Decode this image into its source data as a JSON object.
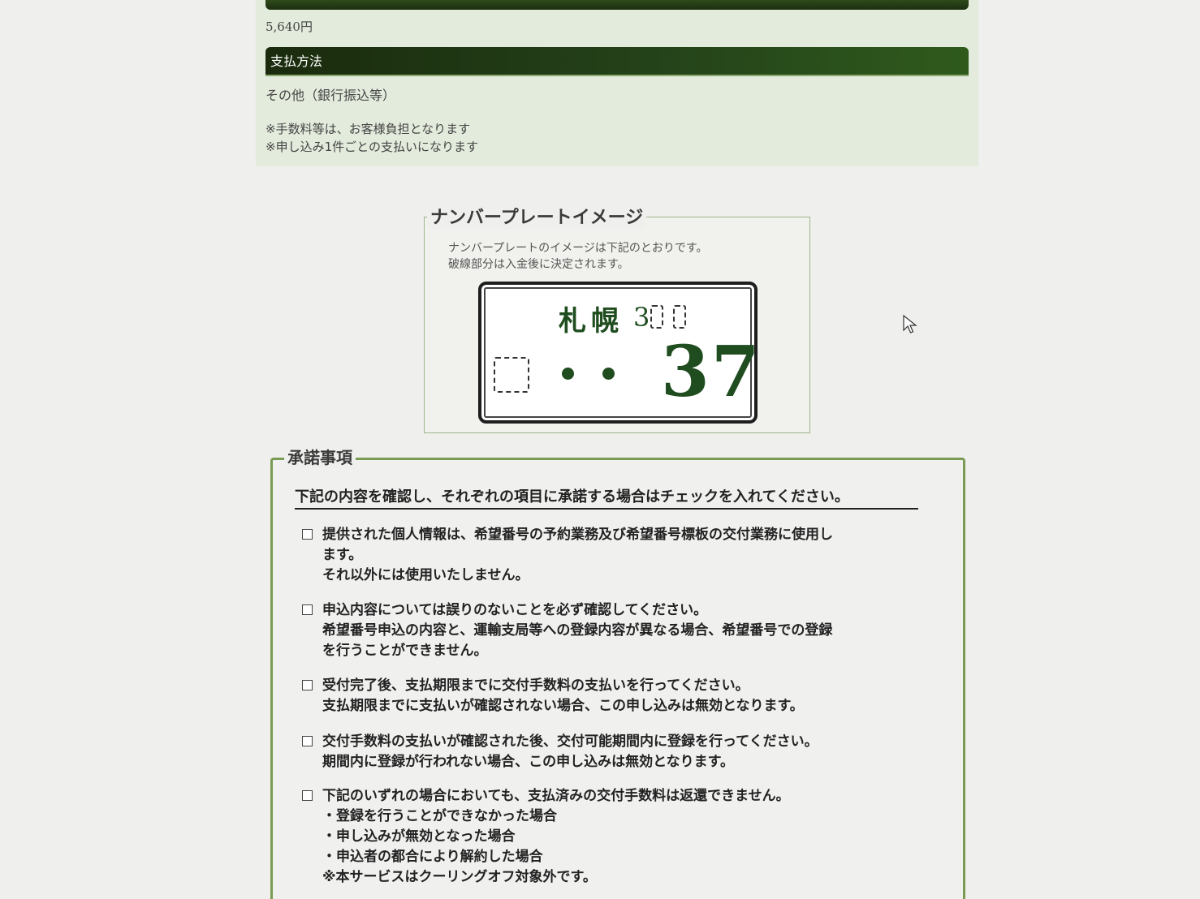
{
  "summary": {
    "fee_amount": "5,640円"
  },
  "payment": {
    "section_title": "支払方法",
    "method": "その他（銀行振込等）",
    "notes": [
      "※手数料等は、お客様負担となります",
      "※申し込み1件ごとの支払いになります"
    ]
  },
  "plate_image": {
    "legend": "ナンバープレートイメージ",
    "description": [
      "ナンバープレートのイメージは下記のとおりです。",
      "破線部分は入金後に決定されます。"
    ],
    "region": "札幌",
    "class_prefix": "3",
    "number": "37"
  },
  "consent": {
    "legend": "承諾事項",
    "intro": "下記の内容を確認し、それぞれの項目に承諾する場合はチェックを入れてください。",
    "items": [
      {
        "lines": [
          "提供された個人情報は、希望番号の予約業務及び希望番号標板の交付業務に使用し",
          "ます。",
          "それ以外には使用いたしません。"
        ],
        "checked": false
      },
      {
        "lines": [
          "申込内容については誤りのないことを必ず確認してください。",
          "希望番号申込の内容と、運輸支局等への登録内容が異なる場合、希望番号での登録",
          "を行うことができません。"
        ],
        "checked": false
      },
      {
        "lines": [
          "受付完了後、支払期限までに交付手数料の支払いを行ってください。",
          "支払期限までに支払いが確認されない場合、この申し込みは無効となります。"
        ],
        "checked": false
      },
      {
        "lines": [
          "交付手数料の支払いが確認された後、交付可能期間内に登録を行ってください。",
          "期間内に登録が行われない場合、この申し込みは無効となります。"
        ],
        "checked": false
      },
      {
        "lines": [
          "下記のいずれの場合においても、支払済みの交付手数料は返還できません。",
          "・登録を行うことができなかった場合",
          "・申し込みが無効となった場合",
          "・申込者の都合により解約した場合",
          "※本サービスはクーリングオフ対象外です。"
        ],
        "checked": false
      }
    ]
  },
  "colors": {
    "header_dark": "#1a2b0d",
    "panel_bg": "#e3ebdc",
    "plate_text": "#1f4d1f",
    "consent_border": "#7a9b53"
  }
}
